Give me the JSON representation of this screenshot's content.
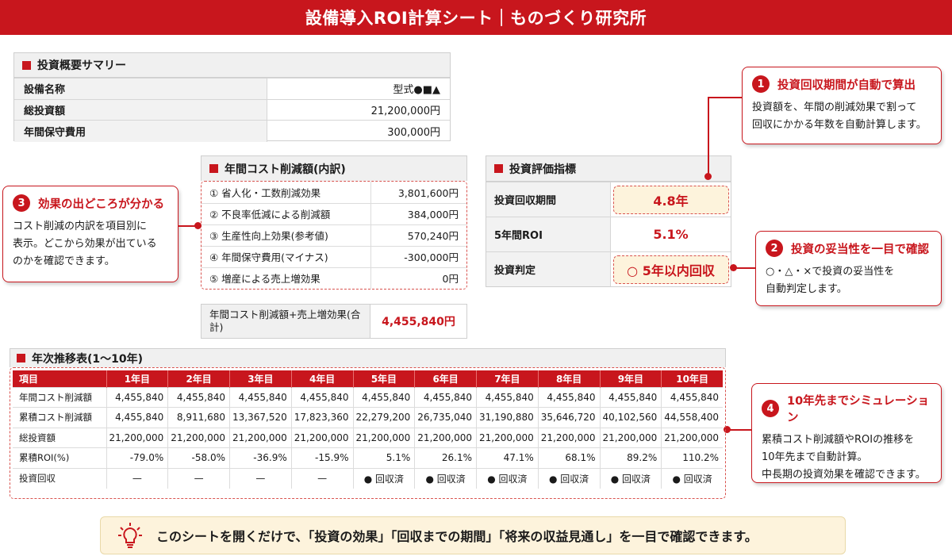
{
  "title": "設備導入ROI計算シート｜ものづくり研究所",
  "summary": {
    "heading": "投資概要サマリー",
    "rows": [
      {
        "label": "設備名称",
        "value": "型式●■▲"
      },
      {
        "label": "総投資額",
        "value": "21,200,000円"
      },
      {
        "label": "年間保守費用",
        "value": "300,000円"
      }
    ]
  },
  "breakdown": {
    "heading": "年間コスト削減額(内訳)",
    "rows": [
      {
        "label": "① 省人化・工数削減効果",
        "value": "3,801,600円"
      },
      {
        "label": "② 不良率低減による削減額",
        "value": "384,000円"
      },
      {
        "label": "③ 生産性向上効果(参考値)",
        "value": "570,240円"
      },
      {
        "label": "④ 年間保守費用(マイナス)",
        "value": "-300,000円"
      },
      {
        "label": "⑤ 増産による売上増効果",
        "value": "0円"
      }
    ],
    "total_label": "年間コスト削減額+売上増効果(合計)",
    "total_value": "4,455,840円"
  },
  "indicators": {
    "heading": "投資評価指標",
    "rows": [
      {
        "label": "投資回収期間",
        "value": "4.8年"
      },
      {
        "label": "5年間ROI",
        "value": "5.1%"
      },
      {
        "label": "投資判定",
        "value": "○ 5年以内回収"
      }
    ]
  },
  "callouts": {
    "c1": {
      "num": "1",
      "title": "投資回収期間が自動で算出",
      "body1": "投資額を、年間の削減効果で割って",
      "body2": "回収にかかる年数を自動計算します。"
    },
    "c2": {
      "num": "2",
      "title": "投資の妥当性を一目で確認",
      "body1": "○・△・×で投資の妥当性を",
      "body2": "自動判定します。"
    },
    "c3": {
      "num": "3",
      "title": "効果の出どころが分かる",
      "body1": "コスト削減の内訳を項目別に",
      "body2": "表示。どこから効果が出ている",
      "body3": "のかを確認できます。"
    },
    "c4": {
      "num": "4",
      "title": "10年先までシミュレーション",
      "body1": "累積コスト削減額やROIの推移を",
      "body2": "10年先まで自動計算。",
      "body3": "中長期の投資効果を確認できます。"
    }
  },
  "yearly": {
    "heading": "年次推移表(1〜10年)",
    "columns": [
      "項目",
      "1年目",
      "2年目",
      "3年目",
      "4年目",
      "5年目",
      "6年目",
      "7年目",
      "8年目",
      "9年目",
      "10年目"
    ],
    "rows": [
      [
        "年間コスト削減額",
        "4,455,840",
        "4,455,840",
        "4,455,840",
        "4,455,840",
        "4,455,840",
        "4,455,840",
        "4,455,840",
        "4,455,840",
        "4,455,840",
        "4,455,840"
      ],
      [
        "累積コスト削減額",
        "4,455,840",
        "8,911,680",
        "13,367,520",
        "17,823,360",
        "22,279,200",
        "26,735,040",
        "31,190,880",
        "35,646,720",
        "40,102,560",
        "44,558,400"
      ],
      [
        "総投資額",
        "21,200,000",
        "21,200,000",
        "21,200,000",
        "21,200,000",
        "21,200,000",
        "21,200,000",
        "21,200,000",
        "21,200,000",
        "21,200,000",
        "21,200,000"
      ],
      [
        "累積ROI(%)",
        "-79.0%",
        "-58.0%",
        "-36.9%",
        "-15.9%",
        "5.1%",
        "26.1%",
        "47.1%",
        "68.1%",
        "89.2%",
        "110.2%"
      ],
      [
        "投資回収",
        "—",
        "—",
        "—",
        "—",
        "● 回収済",
        "● 回収済",
        "● 回収済",
        "● 回収済",
        "● 回収済",
        "● 回収済"
      ]
    ]
  },
  "banner": {
    "icon": "lightbulb-icon",
    "text": "このシートを開くだけで、「投資の効果」「回収までの期間」「将来の収益見通し」を一目で確認できます。"
  },
  "colors": {
    "accent": "#c8161d",
    "highlight": "#fdf3dc"
  }
}
